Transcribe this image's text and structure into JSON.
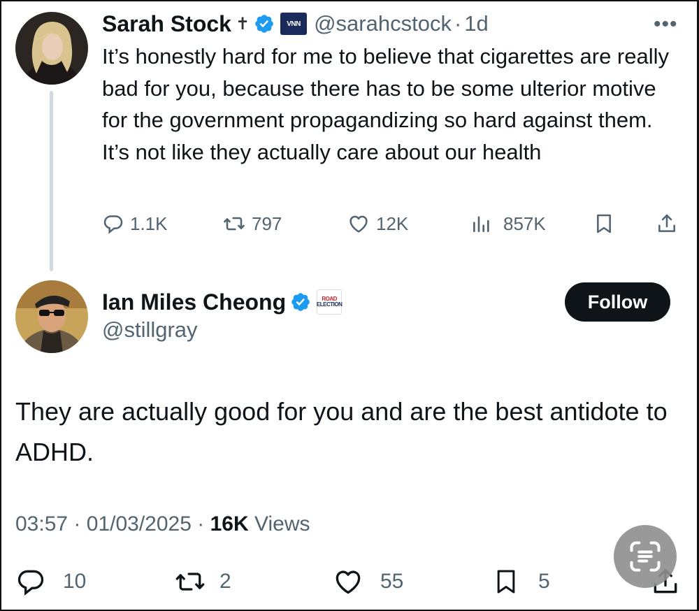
{
  "parent_tweet": {
    "name": "Sarah Stock",
    "cross": "✝",
    "affiliate_logo": "VNN",
    "handle": "@sarahcstock",
    "separator": "·",
    "time": "1d",
    "more": "•••",
    "text": "It’s honestly hard for me to believe that cigarettes are really bad for you, because there has to be some ulterior motive for the government propagandizing so hard against them. It’s not like they actually care about our health",
    "actions": {
      "replies": "1.1K",
      "reposts": "797",
      "likes": "12K",
      "views": "857K"
    }
  },
  "main_tweet": {
    "name": "Ian Miles Cheong",
    "affiliate_logo_line1": "ROAD",
    "affiliate_logo_line2": "ELECTION",
    "handle": "@stillgray",
    "follow_label": "Follow",
    "text": "They are actually good for you and are the best antidote to ADHD.",
    "time": "03:57",
    "date": "01/03/2025",
    "separator": "·",
    "views_count": "16K",
    "views_label": "Views",
    "actions": {
      "replies": "10",
      "reposts": "2",
      "likes": "55",
      "bookmarks": "5"
    }
  },
  "colors": {
    "text": "#0f1419",
    "secondary": "#536471",
    "verified": "#1d9bf0",
    "thread_line": "#cfd9de",
    "follow_bg": "#0f1419"
  },
  "icons": [
    "reply-icon",
    "repost-icon",
    "like-icon",
    "views-icon",
    "bookmark-icon",
    "share-icon",
    "verified-badge-icon",
    "more-icon",
    "text-scan-icon"
  ]
}
